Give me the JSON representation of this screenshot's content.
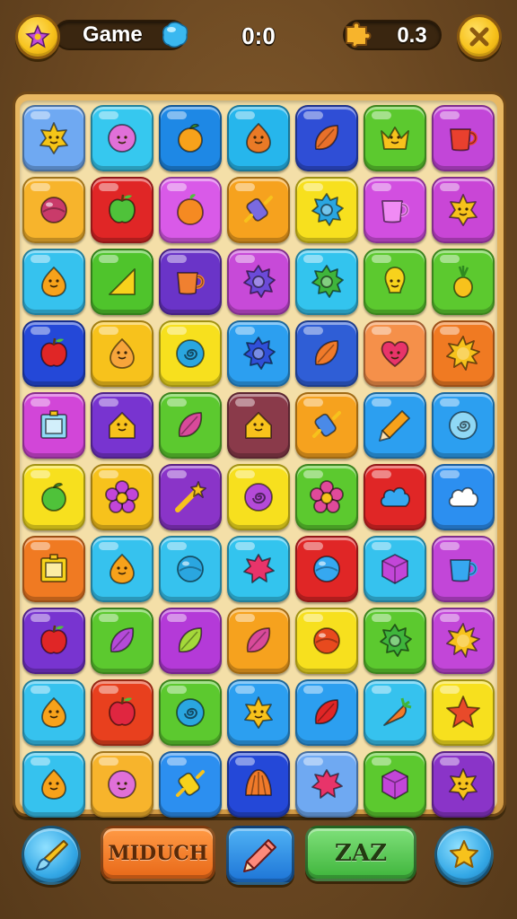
{
  "header": {
    "title": "Game",
    "score": "0:0",
    "bonus_value": "0.3",
    "menu_icon": "star-badge-icon",
    "close_icon": "close-x-icon"
  },
  "bottom_bar": {
    "left_tool_icon": "brush-icon",
    "orange_button_label": "MIDUCH",
    "pencil_icon": "pencil-icon",
    "green_button_label": "ZAZ",
    "right_tool_icon": "star-icon"
  },
  "board": {
    "columns": 7,
    "rows": 10,
    "tiles": [
      [
        {
          "color": "#6fa9f2",
          "icon": "star-face",
          "ic": "#f5c518"
        },
        {
          "color": "#36c8ef",
          "icon": "face",
          "ic": "#e070d8"
        },
        {
          "color": "#1e88e5",
          "icon": "orange",
          "ic": "#f7a21b"
        },
        {
          "color": "#26b6ec",
          "icon": "drop-fruit",
          "ic": "#e97a26"
        },
        {
          "color": "#2f4ed6",
          "icon": "leaf",
          "ic": "#e9702a"
        },
        {
          "color": "#5cc92f",
          "icon": "crown",
          "ic": "#f7c21c"
        },
        {
          "color": "#c246d8",
          "icon": "mug",
          "ic": "#e9402e"
        }
      ],
      [
        {
          "color": "#f7b42c",
          "icon": "ball",
          "ic": "#c93b6a"
        },
        {
          "color": "#e02626",
          "icon": "apple",
          "ic": "#4fc23a"
        },
        {
          "color": "#d95ae8",
          "icon": "peach",
          "ic": "#f58a22"
        },
        {
          "color": "#f6a21e",
          "icon": "candy",
          "ic": "#7a6ae0"
        },
        {
          "color": "#f7e01e",
          "icon": "gear",
          "ic": "#2aa6e0"
        },
        {
          "color": "#d24fe0",
          "icon": "mug",
          "ic": "#f08bf4"
        },
        {
          "color": "#c946d6",
          "icon": "star-face",
          "ic": "#f7c21c"
        }
      ],
      [
        {
          "color": "#36c2ee",
          "icon": "drop-fruit",
          "ic": "#f7a21b"
        },
        {
          "color": "#4fc42c",
          "icon": "triangle",
          "ic": "#f7d21c"
        },
        {
          "color": "#6a34c8",
          "icon": "mug",
          "ic": "#f08030"
        },
        {
          "color": "#c74ad8",
          "icon": "gear",
          "ic": "#6c4ad8"
        },
        {
          "color": "#33c4ee",
          "icon": "gear",
          "ic": "#3fb53c"
        },
        {
          "color": "#5cc92f",
          "icon": "bulb",
          "ic": "#f7d21c"
        },
        {
          "color": "#5cc92f",
          "icon": "pineapple",
          "ic": "#f7c21c"
        }
      ],
      [
        {
          "color": "#2448d8",
          "icon": "apple",
          "ic": "#e02626"
        },
        {
          "color": "#f7c21c",
          "icon": "drop-fruit",
          "ic": "#f7a53b"
        },
        {
          "color": "#f7e01e",
          "icon": "swirl",
          "ic": "#2aa6e0"
        },
        {
          "color": "#2c9ff0",
          "icon": "gear",
          "ic": "#3050d8"
        },
        {
          "color": "#2f5ed6",
          "icon": "leaf",
          "ic": "#f07a2a"
        },
        {
          "color": "#f5904a",
          "icon": "heart",
          "ic": "#e8346a"
        },
        {
          "color": "#f07a22",
          "icon": "sun",
          "ic": "#f7c21c"
        }
      ],
      [
        {
          "color": "#d246d8",
          "icon": "frame",
          "ic": "#8fd8f5"
        },
        {
          "color": "#7834d0",
          "icon": "house",
          "ic": "#f7c21c"
        },
        {
          "color": "#5cc92f",
          "icon": "leaf",
          "ic": "#d84a9a"
        },
        {
          "color": "#8a3a4a",
          "icon": "house",
          "ic": "#f7c21c"
        },
        {
          "color": "#f6a21e",
          "icon": "candy",
          "ic": "#4a8ae8"
        },
        {
          "color": "#2c9ff0",
          "icon": "pencil",
          "ic": "#f7a21b"
        },
        {
          "color": "#2c9ff0",
          "icon": "swirl",
          "ic": "#8fd8f5"
        }
      ],
      [
        {
          "color": "#f7e01e",
          "icon": "orange",
          "ic": "#4fc23a"
        },
        {
          "color": "#f7c21c",
          "icon": "flower",
          "ic": "#c246d8"
        },
        {
          "color": "#8a34c8",
          "icon": "wand",
          "ic": "#f7c21c"
        },
        {
          "color": "#f7e01e",
          "icon": "swirl",
          "ic": "#b44ad8"
        },
        {
          "color": "#5cc92f",
          "icon": "flower",
          "ic": "#e04a9a"
        },
        {
          "color": "#e02626",
          "icon": "cloud",
          "ic": "#36a8f0"
        },
        {
          "color": "#2c8ff0",
          "icon": "cloud",
          "ic": "#ffffff"
        }
      ],
      [
        {
          "color": "#f07a22",
          "icon": "frame",
          "ic": "#f7d21c"
        },
        {
          "color": "#36c2ee",
          "icon": "drop-fruit",
          "ic": "#f7a21b"
        },
        {
          "color": "#36c2ee",
          "icon": "ball",
          "ic": "#2aa6e0"
        },
        {
          "color": "#33c4ee",
          "icon": "splat",
          "ic": "#e8346a"
        },
        {
          "color": "#e02626",
          "icon": "ball",
          "ic": "#36a8f0"
        },
        {
          "color": "#36c2ee",
          "icon": "cube",
          "ic": "#c246d8"
        },
        {
          "color": "#c246d8",
          "icon": "mug",
          "ic": "#36a8f0"
        }
      ],
      [
        {
          "color": "#7834d0",
          "icon": "apple",
          "ic": "#e02626"
        },
        {
          "color": "#5cc92f",
          "icon": "leaf",
          "ic": "#b44ad8"
        },
        {
          "color": "#b43ad8",
          "icon": "leaf",
          "ic": "#a4d83a"
        },
        {
          "color": "#f6a21e",
          "icon": "leaf",
          "ic": "#d84a9a"
        },
        {
          "color": "#f7e01e",
          "icon": "ball",
          "ic": "#e84a1e"
        },
        {
          "color": "#5cc92f",
          "icon": "gear",
          "ic": "#3fb53c"
        },
        {
          "color": "#c246d8",
          "icon": "sun",
          "ic": "#f7c21c"
        }
      ],
      [
        {
          "color": "#36c2ee",
          "icon": "drop-fruit",
          "ic": "#f7a21b"
        },
        {
          "color": "#e8401e",
          "icon": "apple",
          "ic": "#e02640"
        },
        {
          "color": "#5cc92f",
          "icon": "swirl",
          "ic": "#2aa6e0"
        },
        {
          "color": "#2c9ff0",
          "icon": "star-face",
          "ic": "#f7c21c"
        },
        {
          "color": "#2c9ff0",
          "icon": "leaf",
          "ic": "#e02626"
        },
        {
          "color": "#36c2ee",
          "icon": "carrot",
          "ic": "#f07a2a"
        },
        {
          "color": "#f7e01e",
          "icon": "star",
          "ic": "#e84a2a"
        }
      ],
      [
        {
          "color": "#36c2ee",
          "icon": "drop-fruit",
          "ic": "#f7a21b"
        },
        {
          "color": "#f7b42c",
          "icon": "face",
          "ic": "#e070d8"
        },
        {
          "color": "#2c8ff0",
          "icon": "candy",
          "ic": "#f7d21c"
        },
        {
          "color": "#2448d8",
          "icon": "shell",
          "ic": "#f07a2a"
        },
        {
          "color": "#6fa9f2",
          "icon": "splat",
          "ic": "#e8346a"
        },
        {
          "color": "#5cc92f",
          "icon": "cube",
          "ic": "#c246d8"
        },
        {
          "color": "#8a34c8",
          "icon": "star-face",
          "ic": "#f7c21c"
        }
      ]
    ]
  }
}
